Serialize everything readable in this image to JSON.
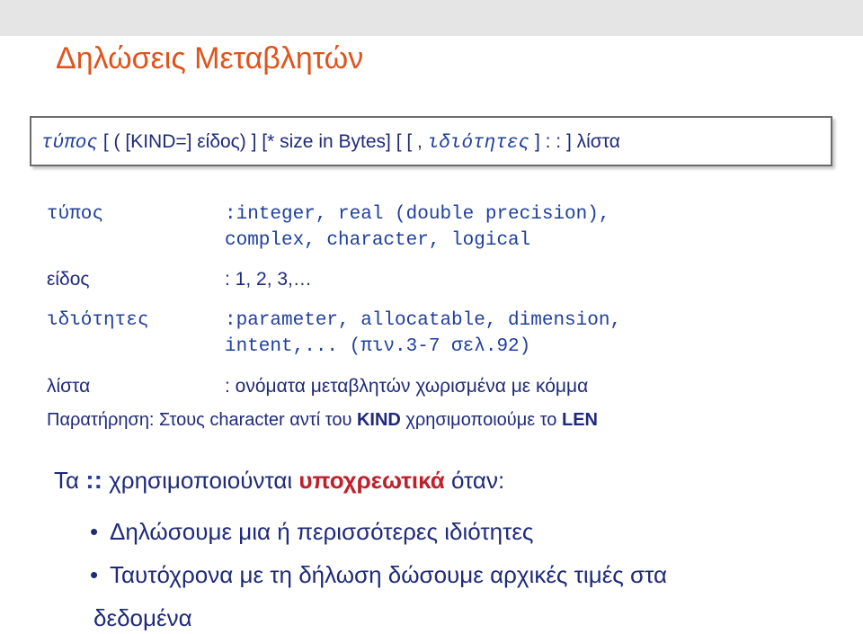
{
  "title": "Δηλώσεις Μεταβλητών",
  "syntax": {
    "t1": "τύπος",
    "t2": " [ ( [KIND=]  είδος) ] [* size in Bytes] [ [ , ",
    "t3": "ιδιότητες",
    "t4": "  ]   : : ]  λίστα"
  },
  "rows": [
    {
      "label": "τύπος",
      "value1": ":integer, real (double precision),",
      "value2": "complex, character, logical"
    },
    {
      "label": "είδος",
      "value1": ": 1, 2, 3,…"
    },
    {
      "label": "ιδιότητες",
      "value1": ":parameter, allocatable, dimension,",
      "value2": "intent,... (πιν.3-7 σελ.92)"
    },
    {
      "label": "λίστα",
      "value1": ": ονόματα μεταβλητών χωρισμένα με κόμμα"
    }
  ],
  "note": {
    "prefix": "Παρατήρηση: Στους character αντί του ",
    "kind": "KIND",
    "middle": " χρησιμοποιούμε το ",
    "len": "LEN"
  },
  "must": {
    "prefix": "Τα ",
    "colons": "::",
    "middle": " χρησιμοποιούνται ",
    "emph": "υποχρεωτικά",
    "suffix": " όταν:"
  },
  "bullets": [
    "Δηλώσουμε μια ή περισσότερες ιδιότητες",
    "Ταυτόχρονα με τη δήλωση δώσουμε αρχικές τιμές στα",
    "δεδομένα"
  ],
  "colors": {
    "title": "#e0541c",
    "text": "#1f2a7a",
    "emphasis": "#c0202a"
  }
}
